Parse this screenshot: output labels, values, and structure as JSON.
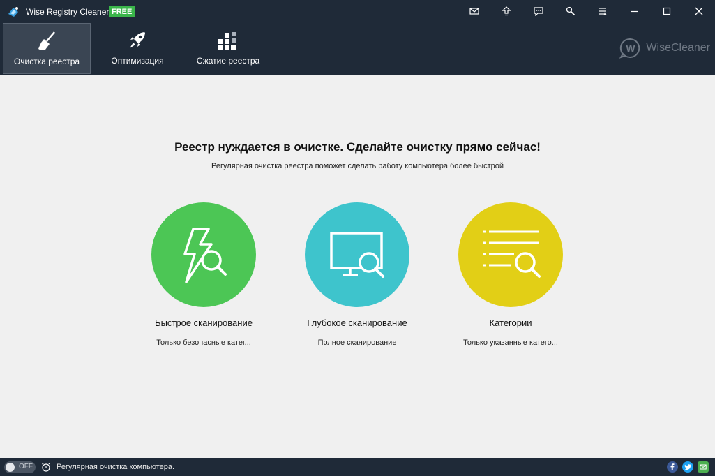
{
  "titlebar": {
    "app_name": "Wise Registry Cleaner X",
    "badge": "FREE"
  },
  "tabs": [
    {
      "label": "Очистка реестра",
      "icon": "broom-icon",
      "active": true
    },
    {
      "label": "Оптимизация",
      "icon": "rocket-icon",
      "active": false
    },
    {
      "label": "Сжатие реестра",
      "icon": "blocks-icon",
      "active": false
    }
  ],
  "brand": {
    "name": "WiseCleaner",
    "logo_letter": "W"
  },
  "main": {
    "headline": "Реестр нуждается в очистке. Сделайте очистку прямо сейчас!",
    "subline": "Регулярная очистка реестра поможет сделать работу компьютера более быстрой",
    "scans": [
      {
        "title": "Быстрое сканирование",
        "desc": "Только безопасные катег...",
        "color": "#4cc655",
        "icon": "lightning-search-icon"
      },
      {
        "title": "Глубокое сканирование",
        "desc": "Полное сканирование",
        "color": "#3ec4cc",
        "icon": "monitor-search-icon"
      },
      {
        "title": "Категории",
        "desc": "Только указанные катего...",
        "color": "#e2cf16",
        "icon": "list-search-icon"
      }
    ]
  },
  "statusbar": {
    "toggle_label": "OFF",
    "text": "Регулярная очистка компьютера."
  },
  "colors": {
    "header_bg": "#1f2a38",
    "body_bg": "#f0f0f0",
    "free_badge": "#3ab54a",
    "facebook": "#3b5998",
    "twitter": "#1da1f2",
    "mail": "#4caf50"
  }
}
